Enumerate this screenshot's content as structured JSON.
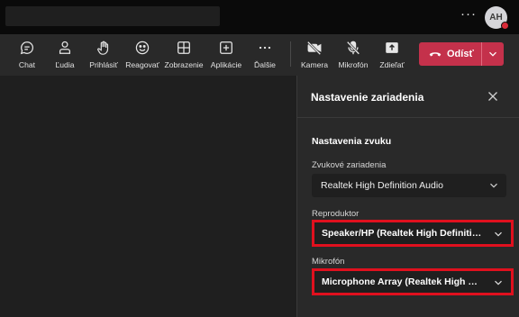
{
  "titlebar": {
    "more_label": "···",
    "avatar_initials": "AH"
  },
  "toolbar": {
    "items": [
      {
        "label": "Chat",
        "icon": "chat-icon"
      },
      {
        "label": "Ľudia",
        "icon": "people-icon"
      },
      {
        "label": "Prihlásiť",
        "icon": "raise-hand-icon"
      },
      {
        "label": "Reagovať",
        "icon": "emoji-icon"
      },
      {
        "label": "Zobrazenie",
        "icon": "view-grid-icon"
      },
      {
        "label": "Aplikácie",
        "icon": "apps-icon"
      },
      {
        "label": "Ďalšie",
        "icon": "more-icon"
      },
      {
        "label": "Kamera",
        "icon": "camera-off-icon"
      },
      {
        "label": "Mikrofón",
        "icon": "mic-off-icon"
      },
      {
        "label": "Zdieľať",
        "icon": "share-icon"
      }
    ],
    "leave_label": "Odísť",
    "leave_color": "#c4314b"
  },
  "panel": {
    "title": "Nastavenie zariadenia",
    "section_title": "Nastavenia zvuku",
    "audio_devices_label": "Zvukové zariadenia",
    "audio_devices_value": "Realtek High Definition Audio",
    "speaker_label": "Reproduktor",
    "speaker_value": "Speaker/HP (Realtek High Definition Audio)",
    "mic_label": "Mikrofón",
    "mic_value": "Microphone Array (Realtek High Definition Audio)",
    "highlight_color": "#e0101e"
  }
}
